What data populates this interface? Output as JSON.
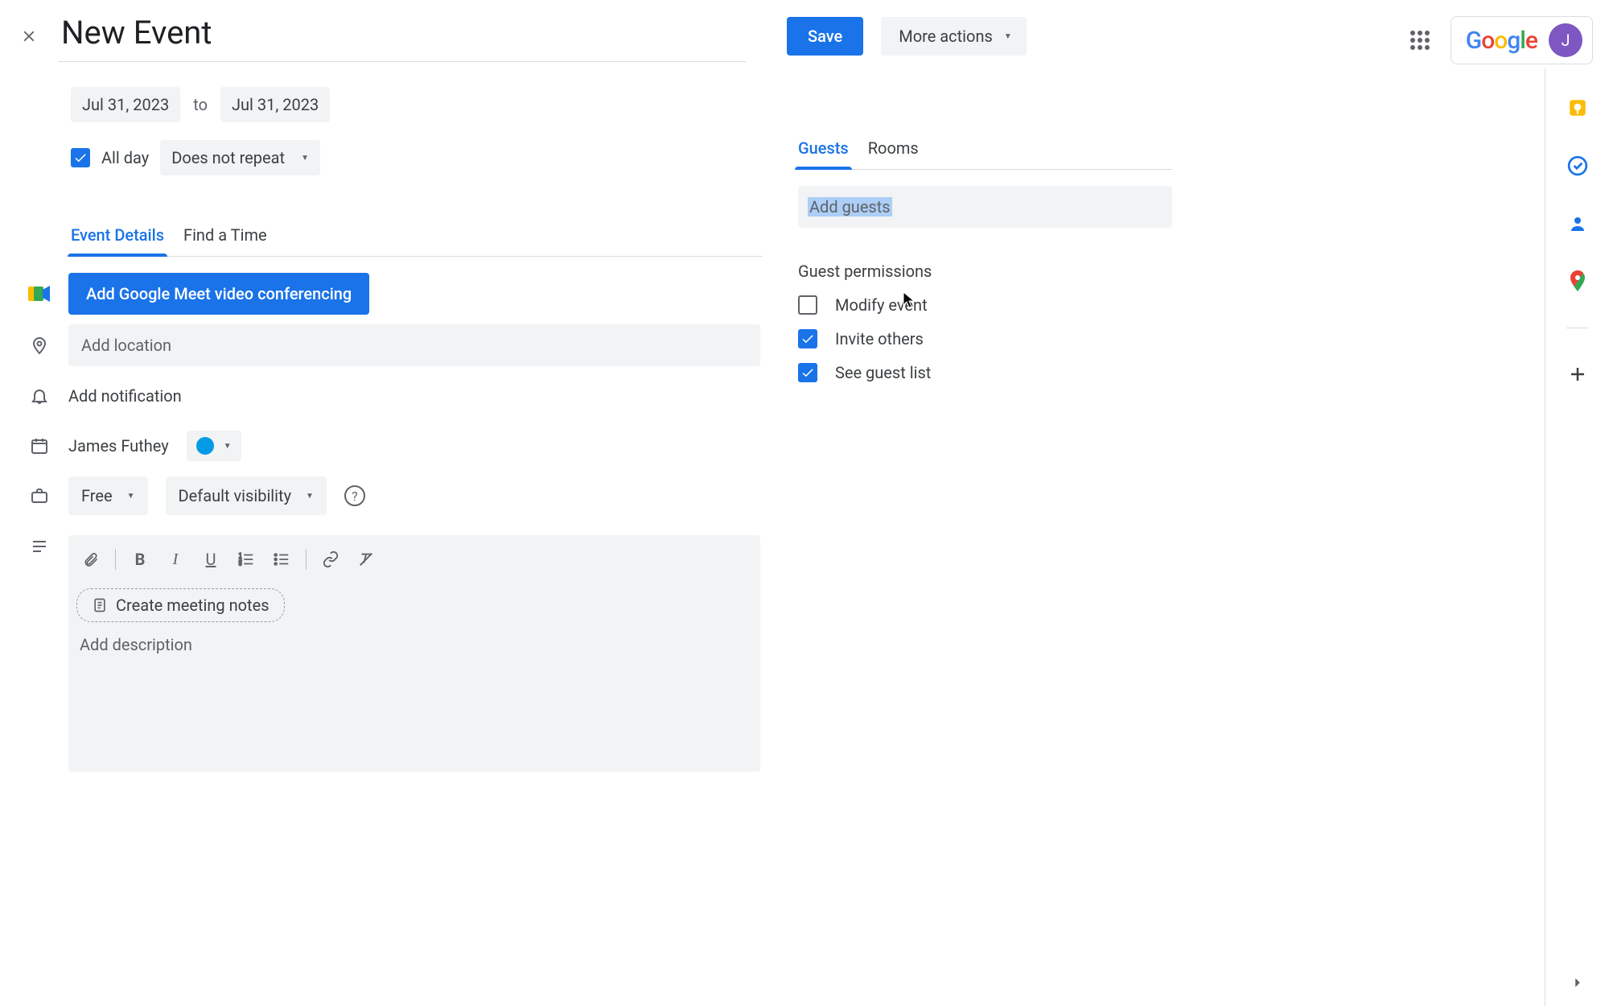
{
  "header": {
    "title": "New Event",
    "save_label": "Save",
    "more_actions_label": "More actions",
    "avatar_initial": "J"
  },
  "dates": {
    "start": "Jul 31, 2023",
    "to_label": "to",
    "end": "Jul 31, 2023",
    "all_day_label": "All day",
    "all_day_checked": true,
    "repeat_label": "Does not repeat"
  },
  "tabs": {
    "event_details": "Event Details",
    "find_a_time": "Find a Time"
  },
  "details": {
    "meet_button": "Add Google Meet video conferencing",
    "location_placeholder": "Add location",
    "add_notification": "Add notification",
    "organizer": "James Futhey",
    "availability": "Free",
    "visibility": "Default visibility",
    "create_notes": "Create meeting notes",
    "description_placeholder": "Add description"
  },
  "guests": {
    "tab_guests": "Guests",
    "tab_rooms": "Rooms",
    "input_placeholder": "Add guests",
    "permissions_title": "Guest permissions",
    "perm_modify": "Modify event",
    "perm_modify_checked": false,
    "perm_invite": "Invite others",
    "perm_invite_checked": true,
    "perm_seelist": "See guest list",
    "perm_seelist_checked": true
  }
}
